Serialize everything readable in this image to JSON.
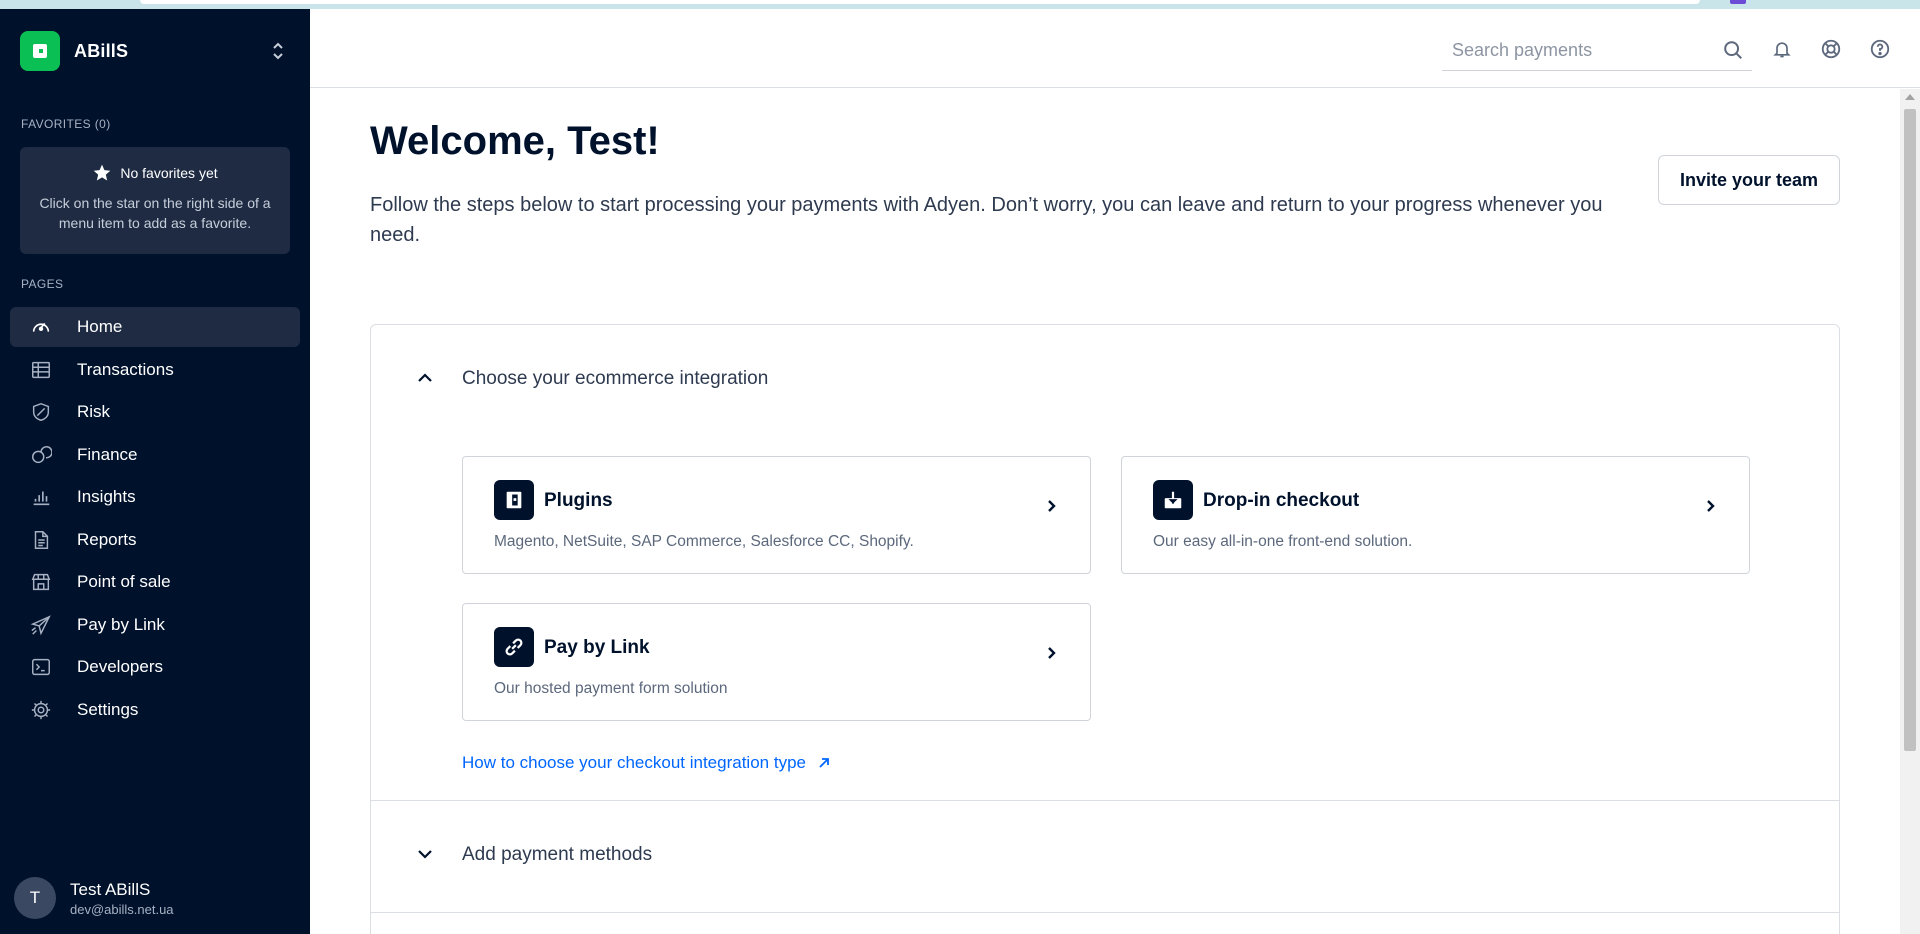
{
  "account": {
    "name": "ABillS"
  },
  "sidebar": {
    "favorites_label": "FAVORITES (0)",
    "favorites_empty_title": "No favorites yet",
    "favorites_empty_text": "Click on the star on the right side of a menu item to add as a favorite.",
    "pages_label": "PAGES",
    "items": [
      {
        "label": "Home",
        "icon": "dashboard-gauge-icon",
        "active": true
      },
      {
        "label": "Transactions",
        "icon": "table-icon"
      },
      {
        "label": "Risk",
        "icon": "shield-icon"
      },
      {
        "label": "Finance",
        "icon": "coins-icon"
      },
      {
        "label": "Insights",
        "icon": "bar-chart-icon"
      },
      {
        "label": "Reports",
        "icon": "document-icon"
      },
      {
        "label": "Point of sale",
        "icon": "store-icon"
      },
      {
        "label": "Pay by Link",
        "icon": "paper-plane-icon"
      },
      {
        "label": "Developers",
        "icon": "terminal-icon"
      },
      {
        "label": "Settings",
        "icon": "gear-icon"
      }
    ]
  },
  "user": {
    "initial": "T",
    "name": "Test ABillS",
    "email": "dev@abills.net.ua"
  },
  "header": {
    "search_placeholder": "Search payments"
  },
  "main": {
    "title": "Welcome, Test!",
    "subtitle": "Follow the steps below to start processing your payments with Adyen. Don’t worry, you can leave and return to your progress whenever you need.",
    "invite_label": "Invite your team",
    "sections": [
      {
        "title": "Choose your ecommerce integration",
        "expanded": true,
        "cards": [
          {
            "title": "Plugins",
            "description": "Magento, NetSuite, SAP Commerce, Salesforce CC, Shopify.",
            "icon": "plugin-icon"
          },
          {
            "title": "Drop-in checkout",
            "description": "Our easy all-in-one front-end solution.",
            "icon": "download-box-icon"
          },
          {
            "title": "Pay by Link",
            "description": "Our hosted payment form solution",
            "icon": "link-icon"
          }
        ],
        "link": "How to choose your checkout integration type"
      },
      {
        "title": "Add payment methods",
        "expanded": false
      }
    ]
  },
  "colors": {
    "sidebar_bg": "#00112c",
    "sidebar_active": "#1e2b43",
    "brand_green": "#0abf53",
    "link_blue": "#0066ff"
  }
}
